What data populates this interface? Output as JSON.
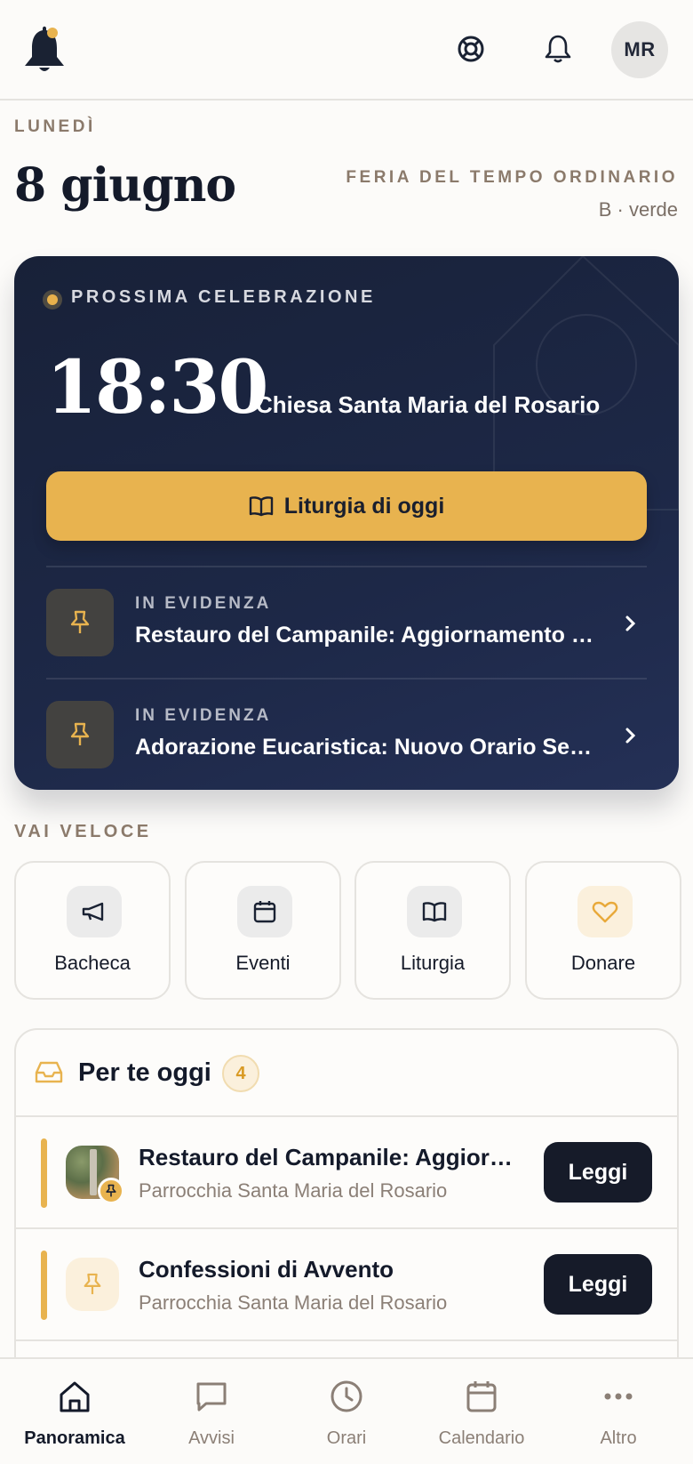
{
  "header": {
    "logo_icon": "bell-icon",
    "help_icon": "lifebuoy-icon",
    "notifications_icon": "bell-outline-icon",
    "avatar_initials": "MR"
  },
  "date": {
    "weekday": "LUNEDÌ",
    "title": "8 giugno",
    "feria": "FERIA DEL TEMPO ORDINARIO",
    "feria_sub": "B · verde"
  },
  "hero": {
    "kicker": "PROSSIMA CELEBRAZIONE",
    "time": "18:30",
    "church": "Chiesa Santa Maria del Rosario",
    "button_label": "Liturgia di oggi",
    "items": [
      {
        "kicker": "IN EVIDENZA",
        "title": "Restauro del Campanile: Aggiornamento lavori"
      },
      {
        "kicker": "IN EVIDENZA",
        "title": "Adorazione Eucaristica: Nuovo Orario Serale"
      }
    ]
  },
  "quick": {
    "label": "VAI VELOCE",
    "items": [
      {
        "label": "Bacheca",
        "icon": "megaphone-icon"
      },
      {
        "label": "Eventi",
        "icon": "calendar-icon"
      },
      {
        "label": "Liturgia",
        "icon": "book-icon"
      },
      {
        "label": "Donare",
        "icon": "heart-icon"
      }
    ]
  },
  "for_you": {
    "title": "Per te oggi",
    "count": "4",
    "rows": [
      {
        "title": "Restauro del Campanile: Aggiornamento lavori",
        "subtitle": "Parrocchia Santa Maria del Rosario",
        "action": "Leggi"
      },
      {
        "title": "Confessioni di Avvento",
        "subtitle": "Parrocchia Santa Maria del Rosario",
        "action": "Leggi"
      }
    ]
  },
  "tabs": [
    {
      "label": "Panoramica",
      "icon": "home-icon",
      "active": true
    },
    {
      "label": "Avvisi",
      "icon": "chat-icon",
      "active": false
    },
    {
      "label": "Orari",
      "icon": "clock-icon",
      "active": false
    },
    {
      "label": "Calendario",
      "icon": "calendar-icon",
      "active": false
    },
    {
      "label": "Altro",
      "icon": "more-icon",
      "active": false
    }
  ],
  "colors": {
    "accent": "#e8b34f",
    "hero_bg": "#1d2847",
    "ink": "#141a2a"
  }
}
